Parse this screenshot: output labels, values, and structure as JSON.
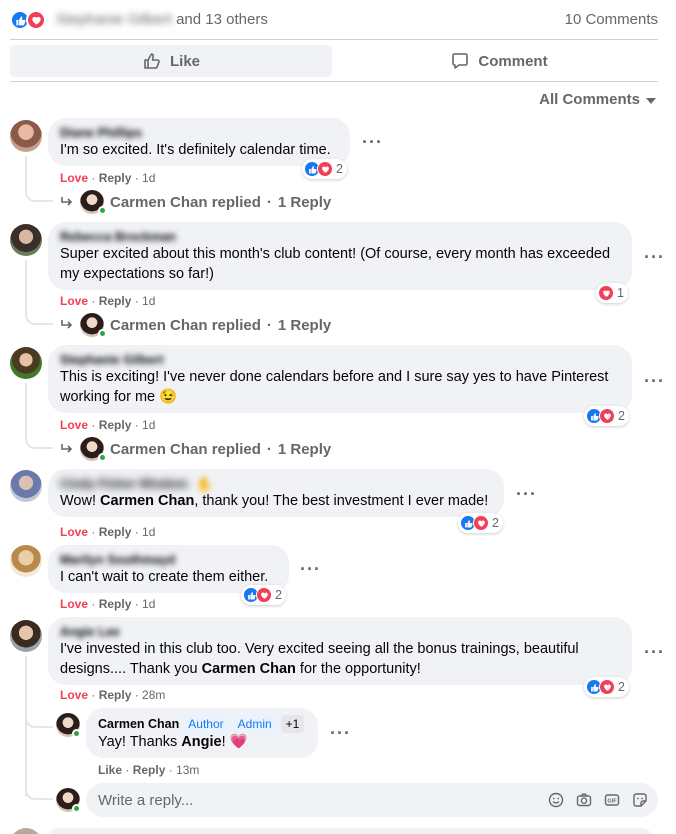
{
  "summary": {
    "blurred_name": "Stephanie Gilbert",
    "others": "and 13 others",
    "comments_count": "10 Comments"
  },
  "actions": {
    "like": "Like",
    "comment": "Comment"
  },
  "filter": {
    "label": "All Comments"
  },
  "comments": [
    {
      "author": "Diane Phillips",
      "text": "I'm so excited. It's definitely calendar time.",
      "reaction_label": "Love",
      "reply_label": "Reply",
      "time": "1d",
      "reaction_count": "2",
      "replied_by": "Carmen Chan replied",
      "reply_count": "1 Reply"
    },
    {
      "author": "Rebecca Brockman",
      "text": "Super excited about this month's club content! (Of course, every month has exceeded my expectations so far!)",
      "reaction_label": "Love",
      "reply_label": "Reply",
      "time": "1d",
      "reaction_count": "1",
      "replied_by": "Carmen Chan replied",
      "reply_count": "1 Reply"
    },
    {
      "author": "Stephanie Gilbert",
      "text": "This is exciting! I've never done calendars before and I sure say yes to have Pinterest working for me",
      "emoji": "😉",
      "reaction_label": "Love",
      "reply_label": "Reply",
      "time": "1d",
      "reaction_count": "2",
      "replied_by": "Carmen Chan replied",
      "reply_count": "1 Reply"
    },
    {
      "author": "Cindy Fisher Wisdom",
      "text_before": "Wow! ",
      "mention": "Carmen Chan",
      "text_after": ", thank you! The best investment I ever made!",
      "reaction_label": "Love",
      "reply_label": "Reply",
      "time": "1d",
      "reaction_count": "2"
    },
    {
      "author": "Marilyn Southmayd",
      "text": "I can't wait to create them either.",
      "reaction_label": "Love",
      "reply_label": "Reply",
      "time": "1d",
      "reaction_count": "2"
    },
    {
      "author": "Angie Lee",
      "text_before": "I've invested in this club too. Very excited seeing all the bonus trainings, beautiful designs.... Thank you ",
      "mention": "Carmen Chan",
      "text_after": " for the opportunity!",
      "reaction_label": "Love",
      "reply_label": "Reply",
      "time": "28m",
      "reaction_count": "2"
    }
  ],
  "reply": {
    "author": "Carmen Chan",
    "badge_author": "Author",
    "badge_admin": "Admin",
    "badge_more": "+1",
    "text_before": "Yay! Thanks ",
    "mention": "Angie",
    "text_after": "!",
    "emoji": "💗",
    "like_label": "Like",
    "reply_label": "Reply",
    "time": "13m"
  },
  "reply_box": {
    "placeholder": "Write a reply..."
  },
  "icons": {
    "like": "thumbs-up-icon",
    "love": "heart-icon",
    "comment": "speech-bubble-icon",
    "more": "ellipsis-icon",
    "reply_arrow": "reply-arrow-icon",
    "emoji": "smiley-icon",
    "camera": "camera-icon",
    "gif": "gif-icon",
    "sticker": "sticker-icon"
  },
  "colors": {
    "like_blue": "#1877f2",
    "love_red": "#f33e58",
    "muted": "#65676b",
    "bubble": "#f0f2f5"
  }
}
